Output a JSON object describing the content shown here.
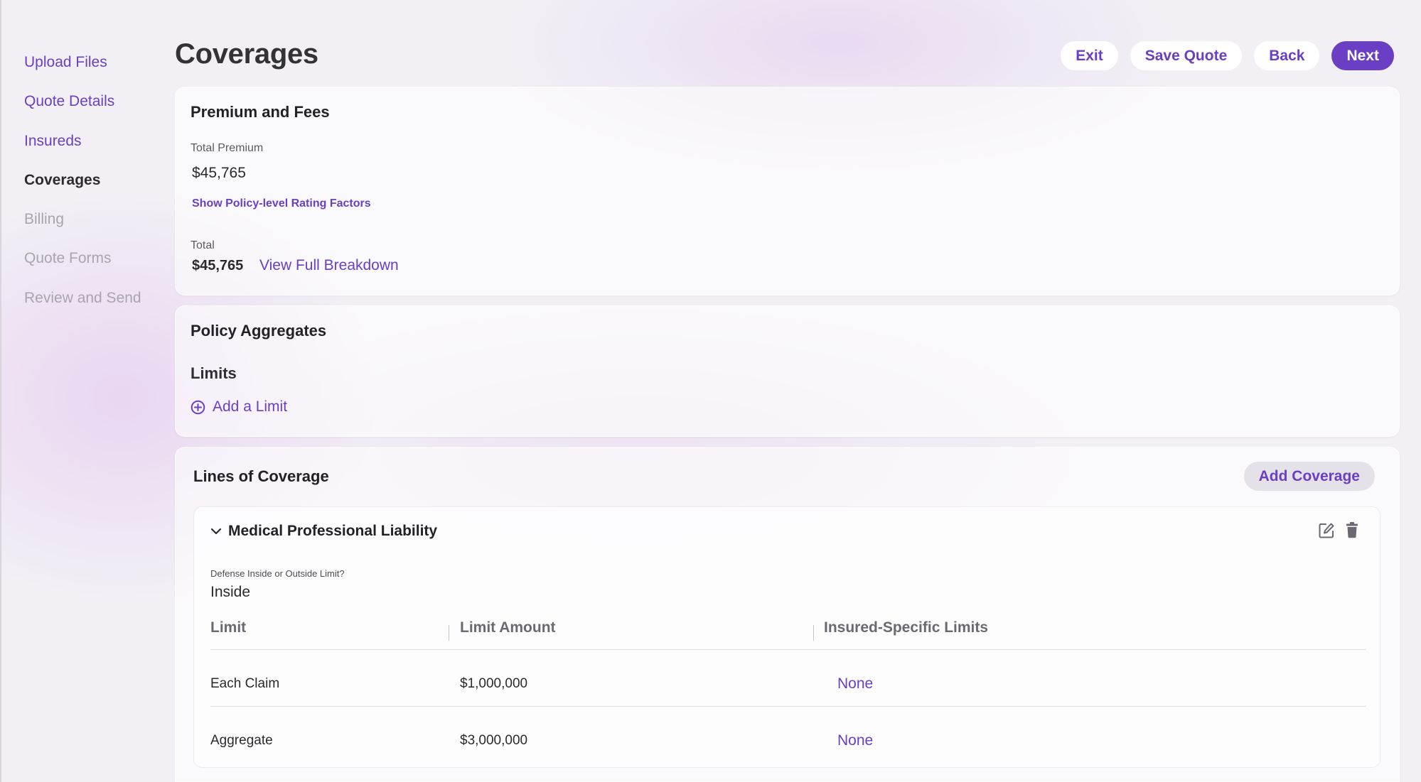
{
  "sidebar": {
    "items": [
      {
        "label": "Upload Files",
        "state": "link"
      },
      {
        "label": "Quote Details",
        "state": "link"
      },
      {
        "label": "Insureds",
        "state": "link"
      },
      {
        "label": "Coverages",
        "state": "active"
      },
      {
        "label": "Billing",
        "state": "disabled"
      },
      {
        "label": "Quote Forms",
        "state": "disabled"
      },
      {
        "label": "Review and Send",
        "state": "disabled"
      }
    ]
  },
  "header": {
    "title": "Coverages",
    "exit_label": "Exit",
    "save_label": "Save Quote",
    "back_label": "Back",
    "next_label": "Next"
  },
  "premium": {
    "title": "Premium and Fees",
    "total_premium_label": "Total Premium",
    "total_premium_value": "$45,765",
    "rating_factors_link": "Show Policy-level Rating Factors",
    "total_label": "Total",
    "total_value": "$45,765",
    "breakdown_link": "View Full Breakdown"
  },
  "aggregates": {
    "title": "Policy Aggregates",
    "limits_title": "Limits",
    "add_limit_label": "Add a Limit"
  },
  "lines": {
    "title": "Lines of Coverage",
    "add_coverage_label": "Add Coverage",
    "coverage": {
      "name": "Medical Professional Liability",
      "defense_label": "Defense Inside or Outside Limit?",
      "defense_value": "Inside",
      "columns": [
        "Limit",
        "Limit Amount",
        "Insured-Specific Limits"
      ],
      "rows": [
        {
          "limit": "Each Claim",
          "amount": "$1,000,000",
          "insured_specific": "None"
        },
        {
          "limit": "Aggregate",
          "amount": "$3,000,000",
          "insured_specific": "None"
        }
      ]
    }
  },
  "colors": {
    "accent": "#6b3fc4",
    "disabled": "#a8a5ad",
    "background": "#f2f0f5"
  },
  "icons": {
    "add_limit": "plus-circle-icon",
    "collapse": "chevron-down-icon",
    "edit": "edit-icon",
    "delete": "trash-icon"
  }
}
